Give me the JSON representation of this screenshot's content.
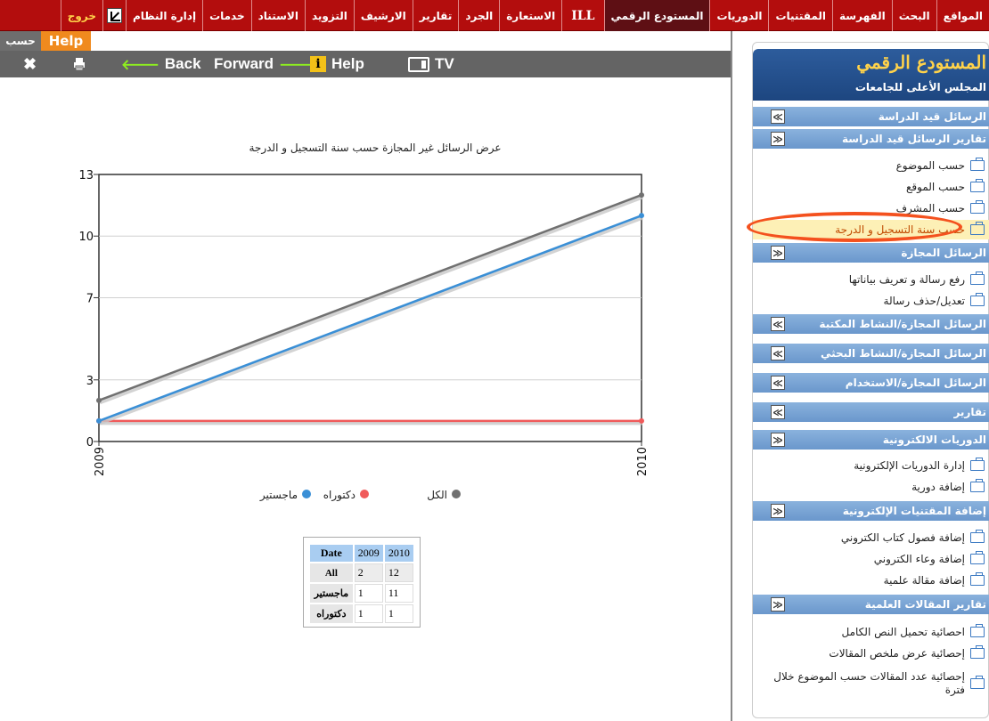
{
  "topnav": {
    "items": [
      {
        "label": "المواقع"
      },
      {
        "label": "البحث"
      },
      {
        "label": "الفهرسة"
      },
      {
        "label": "المقتنيات"
      },
      {
        "label": "الدوريات"
      },
      {
        "label": "المستودع الرقمي",
        "active": true
      },
      {
        "label": "ILL"
      },
      {
        "label": "الاستعارة"
      },
      {
        "label": "الجرد"
      },
      {
        "label": "تقارير"
      },
      {
        "label": "الارشيف"
      },
      {
        "label": "التزويد"
      },
      {
        "label": "الاستناد"
      },
      {
        "label": "خدمات"
      },
      {
        "label": "إدارة النظام"
      }
    ],
    "pin_icon": "pin-icon",
    "exit_label": "خروج",
    "colors": {
      "bar": "#b30d0d",
      "active": "#5e0f14",
      "exit": "#ffd24a"
    }
  },
  "tabs": {
    "hasab": "حسب",
    "help": "Help"
  },
  "toolbar": {
    "close_glyph": "✖",
    "print_glyph": "🖶",
    "back_label": "Back",
    "back_glyph": "🡐",
    "forward_label": "Forward",
    "forward_glyph": "🡒",
    "help_label": "Help",
    "help_badge": "i",
    "tv_label": "TV"
  },
  "chart_data": {
    "type": "line",
    "title": "عرض الرسائل غير المجازة حسب سنة التسجيل و الدرجة",
    "x": [
      "2009",
      "2010"
    ],
    "ylim": [
      0,
      13
    ],
    "yticks": [
      "0",
      "3",
      "7",
      "10",
      "13"
    ],
    "grid": true,
    "legend_position": "bottom",
    "series": [
      {
        "name": "الكل",
        "values": [
          2,
          12
        ],
        "color": "#707070"
      },
      {
        "name": "دكتوراه",
        "values": [
          1,
          1
        ],
        "color": "#f05a5a"
      },
      {
        "name": "ماجستير",
        "values": [
          1,
          11
        ],
        "color": "#3a8fd6"
      }
    ]
  },
  "table": {
    "header": [
      "Date",
      "2009",
      "2010"
    ],
    "rows": [
      {
        "label": "All",
        "v2009": "2",
        "v2010": "12"
      },
      {
        "label": "ماجستير",
        "v2009": "1",
        "v2010": "11"
      },
      {
        "label": "دكتوراه",
        "v2009": "1",
        "v2010": "1"
      }
    ]
  },
  "sidebar": {
    "title": "المستودع الرقمي",
    "subtitle": "المجلس الأعلى للجامعات",
    "sec1": "الرسائل قيد الدراسة",
    "sec2": "تقارير الرسائل قيد الدراسة",
    "sec2_items": [
      "حسب الموضوع",
      "حسب الموقع",
      "حسب المشرف",
      "حسب سنة التسجيل و الدرجة"
    ],
    "sec3": "الرسائل المجازة",
    "sec3_items": [
      "رفع رسالة و تعريف بياناتها",
      "تعديل/حذف رسالة"
    ],
    "sec4": "الرسائل المجازة/النشاط المكتبة",
    "sec5": "الرسائل المجازة/النشاط البحثي",
    "sec6": "الرسائل المجازة/الاستخدام",
    "sec7": "تقارير",
    "sec8": "الدوريات الالكترونية",
    "sec8_items": [
      "إدارة الدوريات الإلكترونية",
      "إضافة دورية"
    ],
    "sec9": "إضافة المقتنيات الإلكترونية",
    "sec9_items": [
      "إضافة فصول كتاب الكتروني",
      "إضافة وعاء الكتروني",
      "إضافة مقالة علمية"
    ],
    "sec10": "تقارير المقالات العلمية",
    "sec10_items": [
      "احصائية تحميل النص الكامل",
      "إحصائية عرض ملخص المقالات",
      "إحصائية عدد المقالات حسب الموضوع خلال فترة"
    ],
    "expand_glyph": "≫",
    "collapse_glyph": "≪",
    "selected_index": 3
  }
}
